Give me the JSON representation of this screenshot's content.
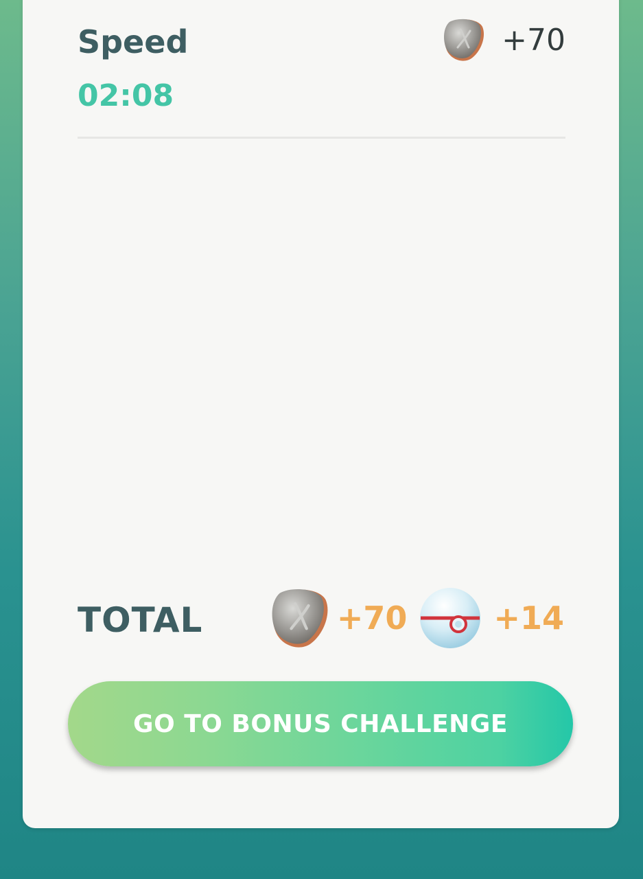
{
  "speed": {
    "label": "Speed",
    "time": "02:08",
    "reward": {
      "icon": "meta-stone-icon",
      "amount": "+70"
    }
  },
  "total": {
    "label": "TOTAL",
    "rewards": [
      {
        "icon": "meta-stone-icon",
        "amount": "+70"
      },
      {
        "icon": "premier-ball-icon",
        "amount": "+14"
      }
    ]
  },
  "button": {
    "label": "GO TO BONUS CHALLENGE"
  },
  "colors": {
    "heading": "#3e5e62",
    "time": "#44c5a6",
    "reward_amount": "#f0ab55",
    "button_start": "#a3d88a",
    "button_end": "#24c7a8"
  }
}
